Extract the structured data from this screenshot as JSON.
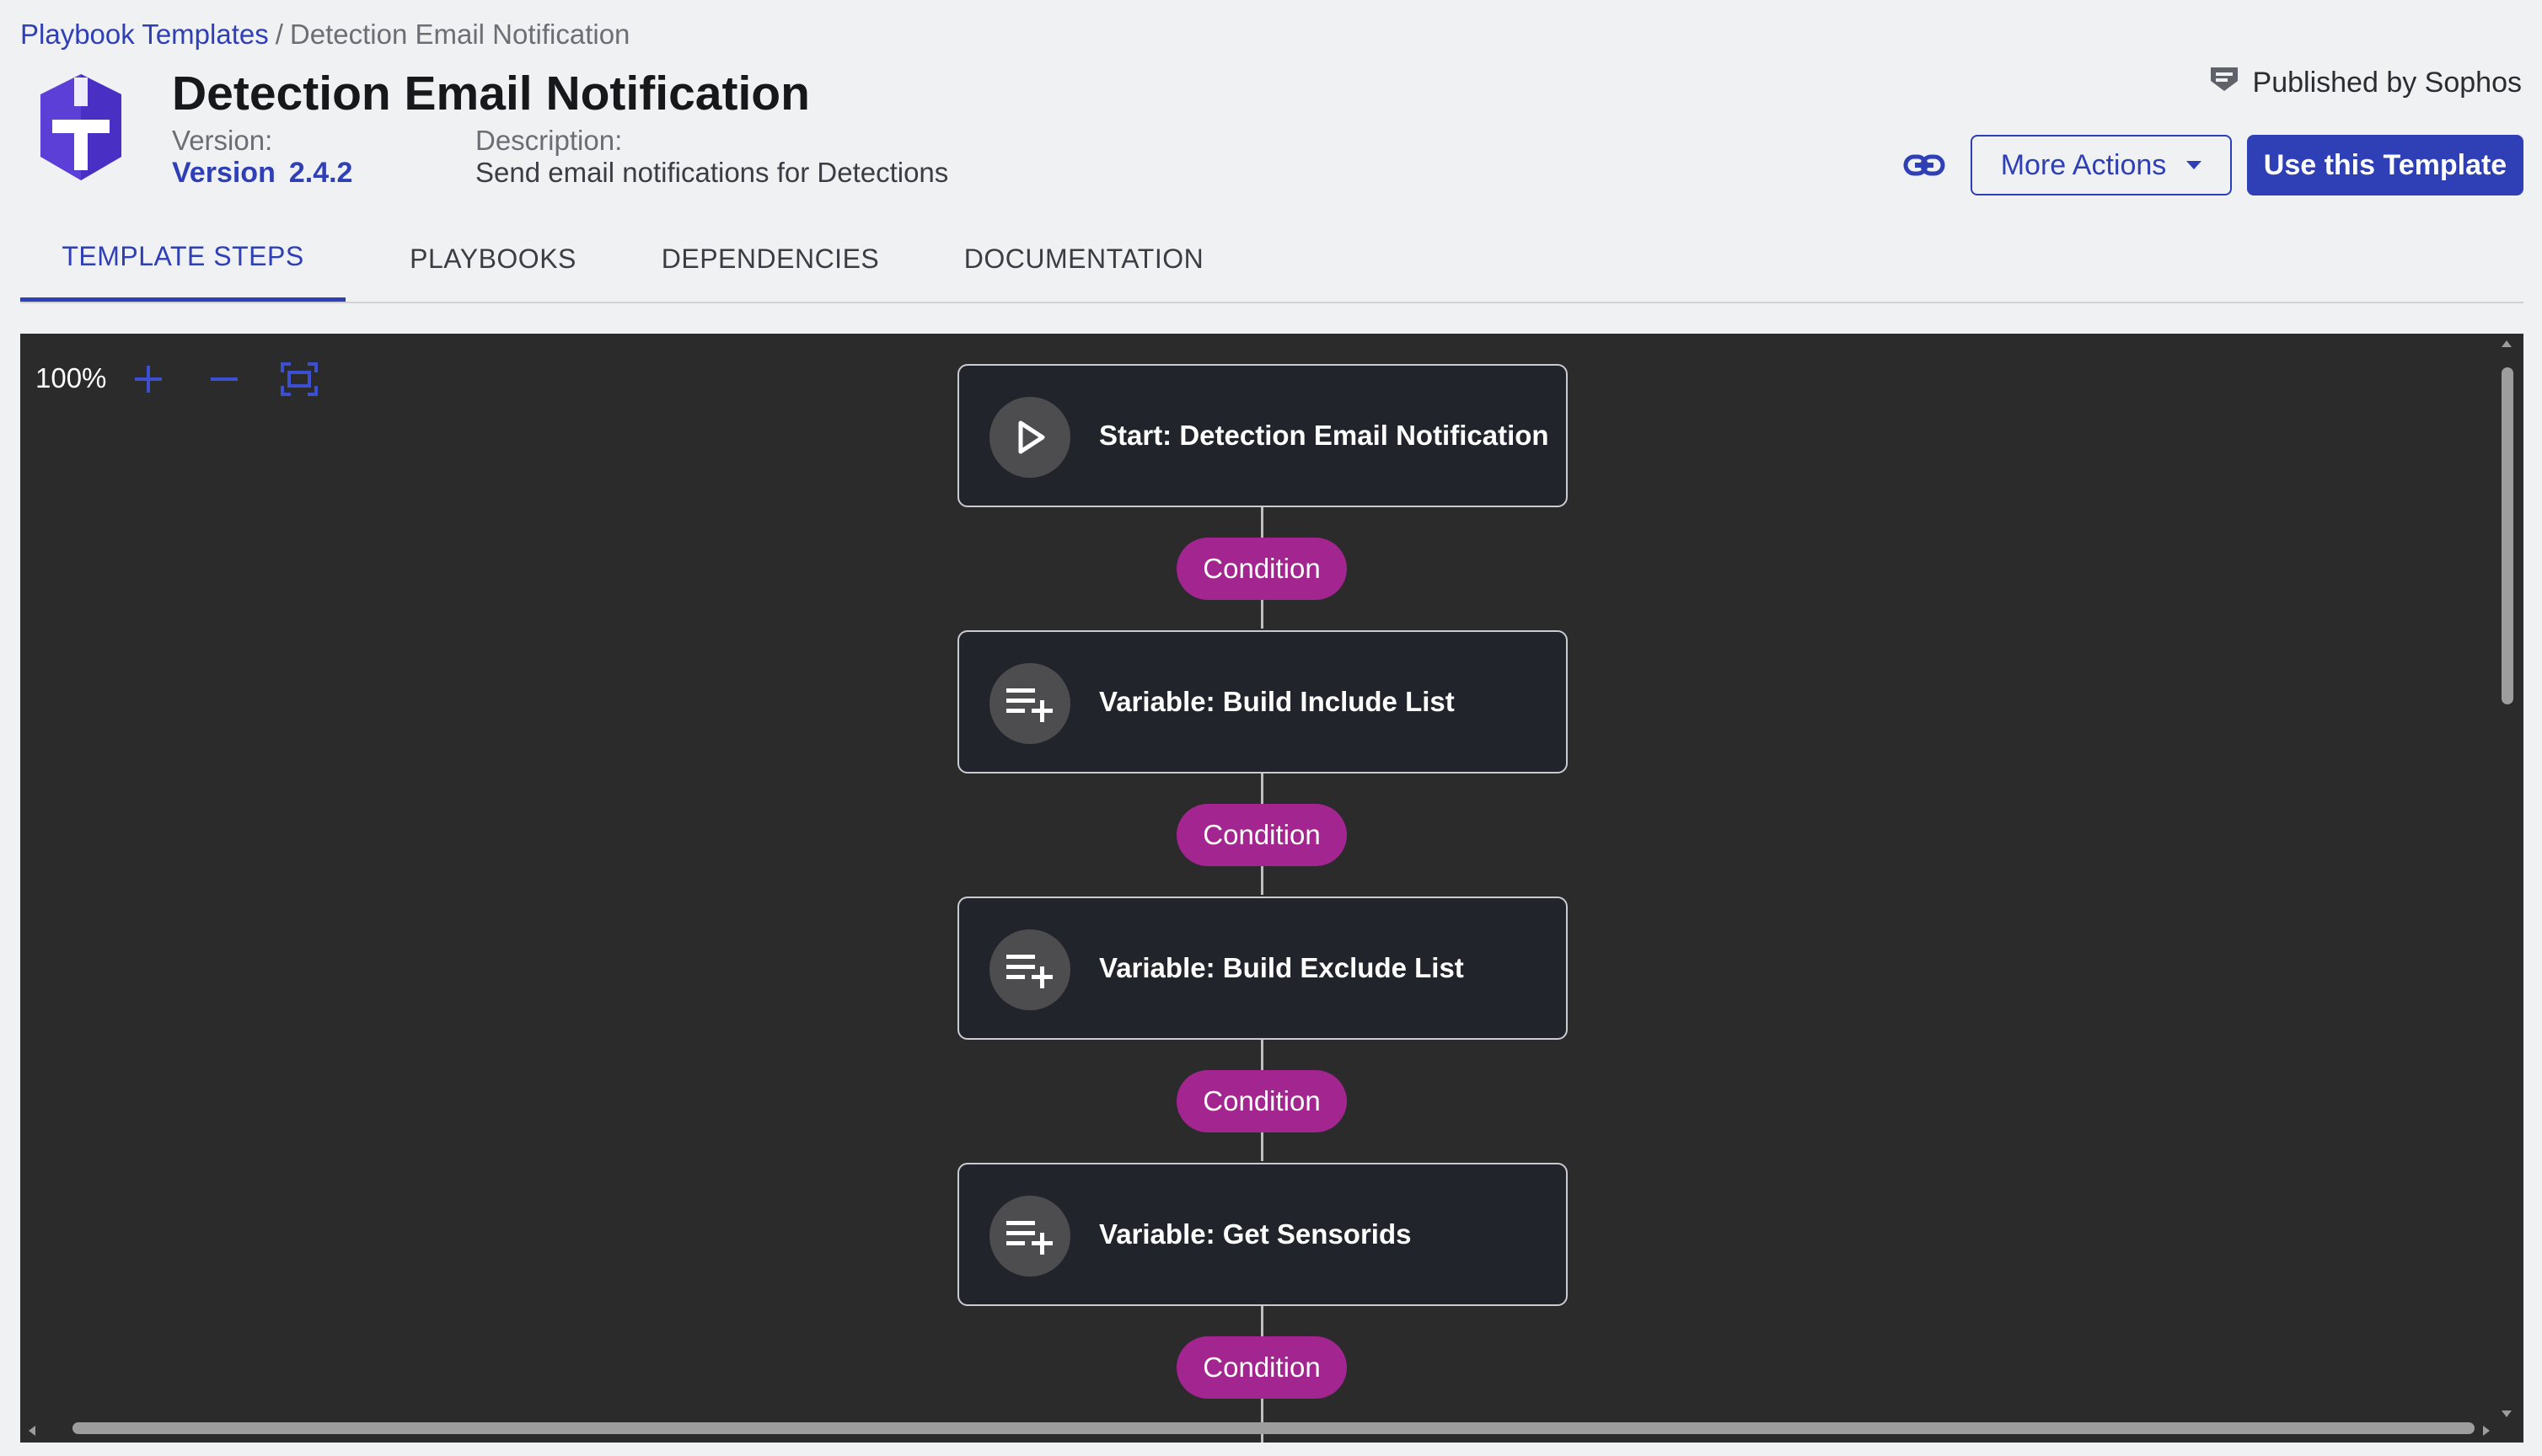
{
  "breadcrumb": {
    "root": "Playbook Templates",
    "separator": "/",
    "current": "Detection Email Notification"
  },
  "header": {
    "logo_icon": "sophos-shield-logo-icon",
    "title": "Detection Email Notification",
    "version_label": "Version:",
    "version_prefix": "Version",
    "version_number": "2.4.2",
    "description_label": "Description:",
    "description": "Send email notifications for Detections",
    "published_by": "Published by Sophos"
  },
  "actions": {
    "copy_link_icon": "link-icon",
    "more_actions": "More Actions",
    "use_template": "Use this Template"
  },
  "tabs": [
    {
      "label": "TEMPLATE STEPS",
      "active": true
    },
    {
      "label": "PLAYBOOKS",
      "active": false
    },
    {
      "label": "DEPENDENCIES",
      "active": false
    },
    {
      "label": "DOCUMENTATION",
      "active": false
    }
  ],
  "canvas": {
    "zoom": "100%",
    "zoom_in_icon": "plus-icon",
    "zoom_out_icon": "minus-icon",
    "fit_icon": "fit-to-screen-icon",
    "nodes": [
      {
        "label": "Start: Detection Email Notification",
        "icon": "play-icon"
      },
      {
        "label": "Variable: Build Include List",
        "icon": "playlist-add-icon"
      },
      {
        "label": "Variable: Build Exclude List",
        "icon": "playlist-add-icon"
      },
      {
        "label": "Variable: Get Sensorids",
        "icon": "playlist-add-icon"
      }
    ],
    "conditions": [
      "Condition",
      "Condition",
      "Condition",
      "Condition"
    ]
  },
  "colors": {
    "primary": "#2f3fb5",
    "condition": "#a3258f",
    "canvas_bg": "#2b2b2b",
    "node_bg": "#21252b",
    "logo": "#5b3fd6"
  }
}
